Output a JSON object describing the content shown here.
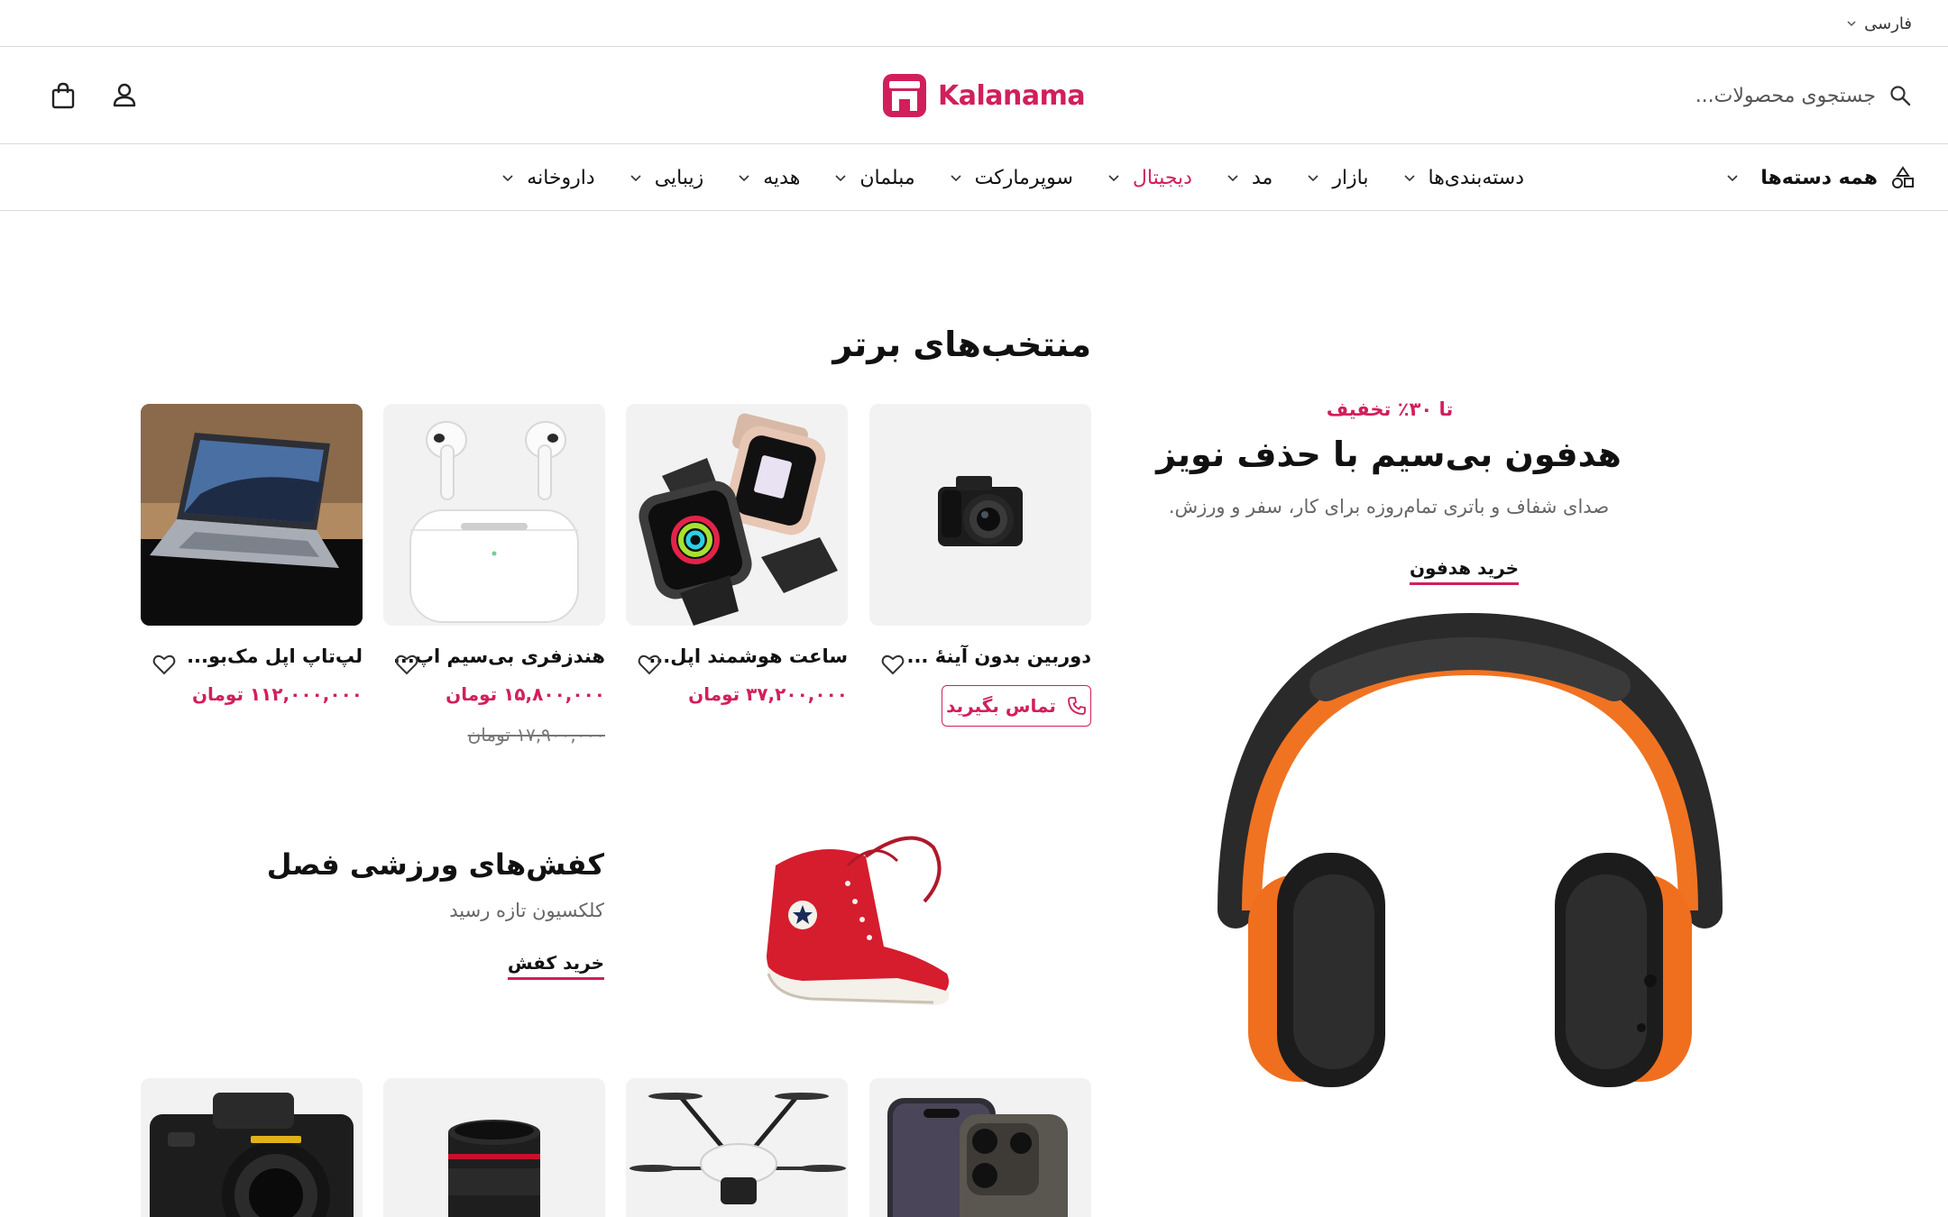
{
  "topbar": {
    "language": "فارسی"
  },
  "header": {
    "search_placeholder": "جستجوی محصولات...",
    "logo_text": "Kalanama",
    "brand_color": "#d11f5c"
  },
  "nav": {
    "all_categories": "همه دسته‌ها",
    "items": [
      {
        "label": "دسته‌بندی‌ها",
        "active": false
      },
      {
        "label": "بازار",
        "active": false
      },
      {
        "label": "مد",
        "active": false
      },
      {
        "label": "دیجیتال",
        "active": true
      },
      {
        "label": "سوپرمارکت",
        "active": false
      },
      {
        "label": "مبلمان",
        "active": false
      },
      {
        "label": "هدیه",
        "active": false
      },
      {
        "label": "زیبایی",
        "active": false
      },
      {
        "label": "داروخانه",
        "active": false
      }
    ]
  },
  "top_picks": {
    "title": "منتخب‌های برتر",
    "products": [
      {
        "name": "دوربین بدون آینهٔ ...",
        "contact_label": "تماس بگیرید",
        "image": "camera-icon"
      },
      {
        "name": "ساعت هوشمند اپل...",
        "price": "۳۷,۲۰۰,۰۰۰ تومان",
        "image": "smartwatch-icon"
      },
      {
        "name": "هندزفری بی‌سیم اپ...",
        "price": "۱۵,۸۰۰,۰۰۰ تومان",
        "old_price": "۱۷,۹۰۰,۰۰۰ تومان",
        "image": "earbuds-icon"
      },
      {
        "name": "لپ‌تاپ اپل مک‌بو...",
        "price": "۱۱۲,۰۰۰,۰۰۰ تومان",
        "image": "laptop-icon"
      }
    ]
  },
  "promo": {
    "badge": "تا ۳۰٪ تخفیف",
    "title": "هدفون بی‌سیم با حذف نویز",
    "subtitle": "صدای شفاف و باتری تمام‌روزه برای کار، سفر و ورزش.",
    "link": "خرید هدفون"
  },
  "shoes_banner": {
    "title": "کفش‌های ورزشی فصل",
    "subtitle": "کلکسیون تازه رسید",
    "link": "خرید کفش"
  }
}
